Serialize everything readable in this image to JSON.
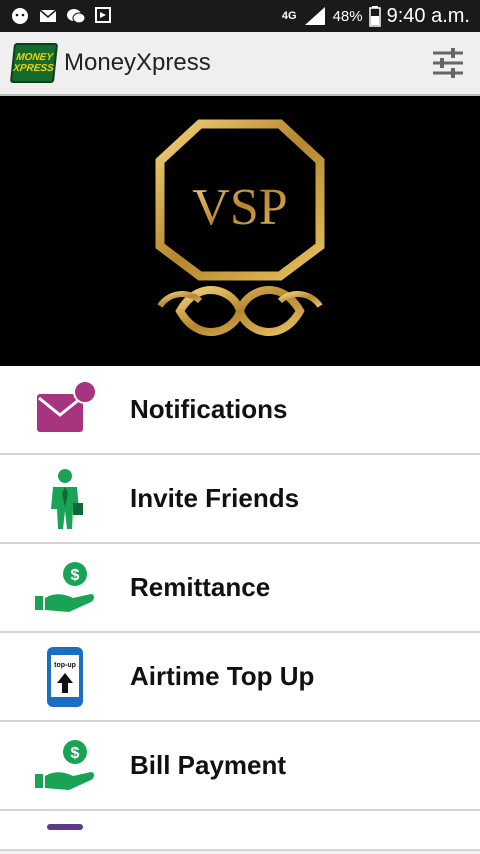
{
  "status_bar": {
    "network": "4G",
    "battery": "48%",
    "time": "9:40 a.m."
  },
  "app_bar": {
    "logo_line1": "MONEY",
    "logo_line2": "XPRESS",
    "title": "MoneyXpress"
  },
  "banner": {
    "brand_text": "VSP"
  },
  "menu": {
    "items": [
      {
        "label": "Notifications",
        "icon": "envelope-icon"
      },
      {
        "label": "Invite Friends",
        "icon": "person-icon"
      },
      {
        "label": "Remittance",
        "icon": "hand-coin-icon"
      },
      {
        "label": "Airtime Top Up",
        "icon": "phone-topup-icon"
      },
      {
        "label": "Bill Payment",
        "icon": "hand-coin-icon"
      }
    ],
    "topup_icon_text": "top-up"
  },
  "colors": {
    "accent_green": "#1aa355",
    "purple": "#a6347f",
    "blue": "#1a6fc4",
    "gold": "#c89a3a"
  }
}
